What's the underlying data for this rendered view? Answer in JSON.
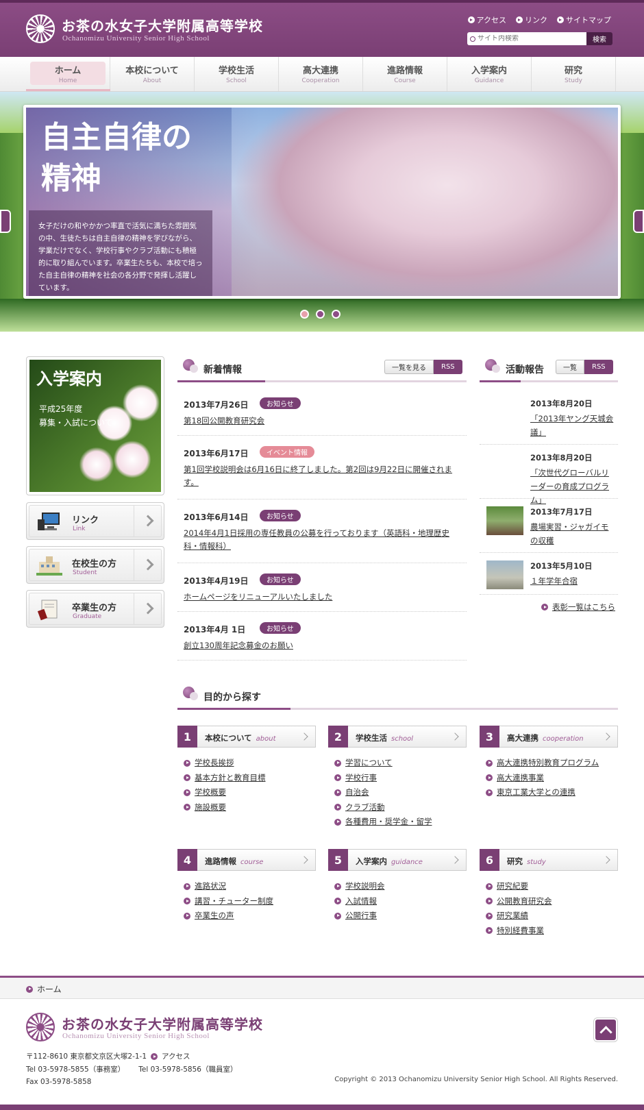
{
  "header": {
    "logo_jp": "お茶の水女子大学附属高等学校",
    "logo_en": "Ochanomizu University Senior High School",
    "links": [
      "アクセス",
      "リンク",
      "サイトマップ"
    ],
    "search_placeholder": "サイト内検索",
    "search_button": "検索"
  },
  "nav": [
    {
      "jp": "ホーム",
      "en": "Home"
    },
    {
      "jp": "本校について",
      "en": "About"
    },
    {
      "jp": "学校生活",
      "en": "School"
    },
    {
      "jp": "高大連携",
      "en": "Cooperation"
    },
    {
      "jp": "進路情報",
      "en": "Course"
    },
    {
      "jp": "入学案内",
      "en": "Guidance"
    },
    {
      "jp": "研究",
      "en": "Study"
    }
  ],
  "hero": {
    "title": "自主自律の\n精神",
    "caption": "女子だけの和やかかつ率直で活気に満ちた雰囲気の中、生徒たちは自主自律の精神を学びながら、学業だけでなく、学校行事やクラブ活動にも積極的に取り組んでいます。卒業生たちも、本校で培った自主自律の精神を社会の各分野で発揮し活躍しています。"
  },
  "sidebar": {
    "banner_title": "入学案内",
    "banner_text": "平成25年度\n募集・入試について",
    "buttons": [
      {
        "jp": "リンク",
        "en": "Link"
      },
      {
        "jp": "在校生の方",
        "en": "Student"
      },
      {
        "jp": "卒業生の方",
        "en": "Graduate"
      }
    ]
  },
  "news": {
    "title": "新着情報",
    "btn_list": "一覧を見る",
    "btn_rss": "RSS",
    "items": [
      {
        "date": "2013年7月26日",
        "badge": "お知らせ",
        "text": "第18回公開教育研究会"
      },
      {
        "date": "2013年6月17日",
        "badge": "イベント情報",
        "text": "第1回学校説明会は6月16日に終了しました。第2回は9月22日に開催されます。"
      },
      {
        "date": "2013年6月14日",
        "badge": "お知らせ",
        "text": "2014年4月1日採用の専任教員の公募を行っております（英語科・地理歴史科・情報科）"
      },
      {
        "date": "2013年4月19日",
        "badge": "お知らせ",
        "text": "ホームページをリニューアルいたしました"
      },
      {
        "date": "2013年4月 1日",
        "badge": "お知らせ",
        "text": "創立130周年記念募金のお願い"
      }
    ]
  },
  "activity": {
    "title": "活動報告",
    "btn_list": "一覧",
    "btn_rss": "RSS",
    "items": [
      {
        "date": "2013年8月20日",
        "text": "「2013年ヤング天城会議」"
      },
      {
        "date": "2013年8月20日",
        "text": "「次世代グローバルリーダーの育成プログラム」"
      },
      {
        "date": "2013年7月17日",
        "text": "農場実習・ジャガイモの収穫"
      },
      {
        "date": "2013年5月10日",
        "text": "１年学年合宿"
      }
    ],
    "more": "表彰一覧はこちら"
  },
  "purpose": {
    "title": "目的から探す",
    "categories": [
      {
        "num": "1",
        "jp": "本校について",
        "en": "about",
        "links": [
          "学校長挨拶",
          "基本方針と教育目標",
          "学校概要",
          "施設概要"
        ]
      },
      {
        "num": "2",
        "jp": "学校生活",
        "en": "school",
        "links": [
          "学習について",
          "学校行事",
          "自治会",
          "クラブ活動",
          "各種費用・奨学金・留学"
        ]
      },
      {
        "num": "3",
        "jp": "高大連携",
        "en": "cooperation",
        "links": [
          "高大連携特別教育プログラム",
          "高大連携事業",
          "東京工業大学との連携"
        ]
      },
      {
        "num": "4",
        "jp": "進路情報",
        "en": "course",
        "links": [
          "進路状況",
          "講習・チューター制度",
          "卒業生の声"
        ]
      },
      {
        "num": "5",
        "jp": "入学案内",
        "en": "guidance",
        "links": [
          "学校説明会",
          "入試情報",
          "公開行事"
        ]
      },
      {
        "num": "6",
        "jp": "研究",
        "en": "study",
        "links": [
          "研究紀要",
          "公開教育研究会",
          "研究業績",
          "特別経費事業"
        ]
      }
    ]
  },
  "footer": {
    "breadcrumb": "ホーム",
    "logo_jp": "お茶の水女子大学附属高等学校",
    "logo_en": "Ochanomizu University Senior High School",
    "address": "〒112-8610 東京都文京区大塚2-1-1",
    "access": "アクセス",
    "tel1": "Tel 03-5978-5855（事務室）",
    "tel2": "Tel 03-5978-5856（職員室）",
    "fax": "Fax 03-5978-5858",
    "copyright": "Copyright © 2013 Ochanomizu University Senior High School. All Rights Reserved."
  }
}
